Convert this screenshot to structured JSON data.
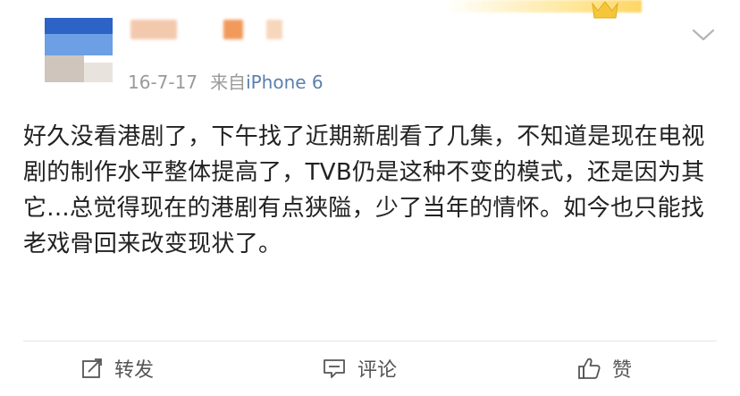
{
  "post": {
    "date": "16-7-17",
    "source_prefix": "来自",
    "source_device": "iPhone 6",
    "content": "好久没看港剧了，下午找了近期新剧看了几集，不知道是现在电视剧的制作水平整体提高了，TVB仍是这种不变的模式，还是因为其它...总觉得现在的港剧有点狭隘，少了当年的情怀。如今也只能找老戏骨回来改变现状了。"
  },
  "actions": {
    "repost_label": "转发",
    "comment_label": "评论",
    "like_label": "赞"
  },
  "colors": {
    "link_blue": "#5b7fae",
    "meta_gray": "#9a9a9a",
    "text": "#222222"
  },
  "icons": {
    "menu": "chevron-down-icon",
    "repost": "repost-icon",
    "comment": "comment-icon",
    "like": "thumbs-up-icon",
    "badge": "crown-icon"
  }
}
